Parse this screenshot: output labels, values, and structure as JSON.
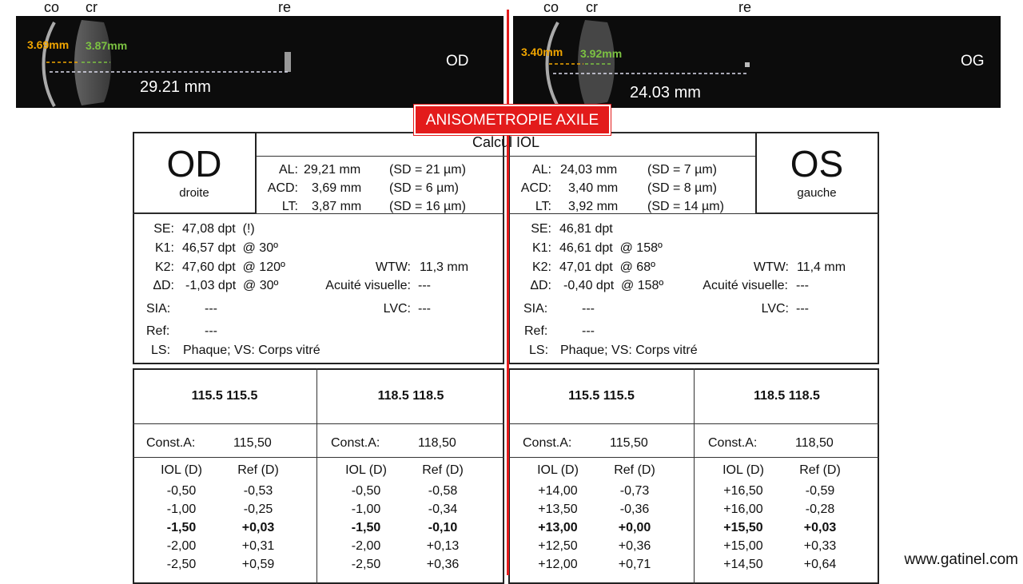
{
  "scans": {
    "od": {
      "labels": {
        "co": "co",
        "cr": "cr",
        "re": "re"
      },
      "acd": "3.69mm",
      "lt": "3.87mm",
      "axial": "29.21 mm",
      "eye": "OD"
    },
    "og": {
      "labels": {
        "co": "co",
        "cr": "cr",
        "re": "re"
      },
      "acd": "3.40mm",
      "lt": "3.92mm",
      "axial": "24.03 mm",
      "eye": "OG"
    }
  },
  "banner": "ANISOMETROPIE AXILE",
  "iol": {
    "title": "Calcul IOL",
    "od": {
      "eye": "OD",
      "eye_sub": "droite",
      "al": {
        "label": "AL:",
        "value": "29,21 mm",
        "sd": "(SD = 21 µm)"
      },
      "acd": {
        "label": "ACD:",
        "value": "3,69 mm",
        "sd": "(SD = 6 µm)"
      },
      "lt": {
        "label": "LT:",
        "value": "3,87 mm",
        "sd": "(SD = 16 µm)"
      },
      "se": {
        "label": "SE:",
        "value": "47,08 dpt  (!)"
      },
      "k1": {
        "label": "K1:",
        "value": "46,57 dpt  @ 30º"
      },
      "k2": {
        "label": "K2:",
        "value": "47,60 dpt  @ 120º"
      },
      "dd": {
        "label": "ΔD:",
        "value": "-1,03 dpt  @ 30º"
      },
      "wtw": {
        "label": "WTW:",
        "value": "11,3 mm"
      },
      "av": {
        "label": "Acuité visuelle:",
        "value": "---"
      },
      "sia": {
        "label": "SIA:",
        "value": "---"
      },
      "lvc": {
        "label": "LVC:",
        "value": "---"
      },
      "ref": {
        "label": "Ref:",
        "value": "---"
      },
      "ls": {
        "label": "LS:",
        "value": "Phaque; VS: Corps vitré"
      }
    },
    "os": {
      "eye": "OS",
      "eye_sub": "gauche",
      "al": {
        "label": "AL:",
        "value": "24,03 mm",
        "sd": "(SD = 7 µm)"
      },
      "acd": {
        "label": "ACD:",
        "value": "3,40 mm",
        "sd": "(SD = 8 µm)"
      },
      "lt": {
        "label": "LT:",
        "value": "3,92 mm",
        "sd": "(SD = 14 µm)"
      },
      "se": {
        "label": "SE:",
        "value": "46,81 dpt"
      },
      "k1": {
        "label": "K1:",
        "value": "46,61 dpt  @ 158º"
      },
      "k2": {
        "label": "K2:",
        "value": "47,01 dpt  @ 68º"
      },
      "dd": {
        "label": "ΔD:",
        "value": "-0,40 dpt  @ 158º"
      },
      "wtw": {
        "label": "WTW:",
        "value": "11,4 mm"
      },
      "av": {
        "label": "Acuité visuelle:",
        "value": "---"
      },
      "sia": {
        "label": "SIA:",
        "value": "---"
      },
      "lvc": {
        "label": "LVC:",
        "value": "---"
      },
      "ref": {
        "label": "Ref:",
        "value": "---"
      },
      "ls": {
        "label": "LS:",
        "value": "Phaque; VS: Corps vitré"
      }
    },
    "tables": [
      {
        "header": "115.5 115.5",
        "const_label": "Const.A:",
        "const_value": "115,50",
        "col_iol": "IOL (D)",
        "col_ref": "Ref (D)",
        "rows": [
          [
            "-0,50",
            "-0,53"
          ],
          [
            "-1,00",
            "-0,25"
          ],
          [
            "-1,50",
            "+0,03"
          ],
          [
            "-2,00",
            "+0,31"
          ],
          [
            "-2,50",
            "+0,59"
          ]
        ],
        "bold_row": 2
      },
      {
        "header": "118.5 118.5",
        "const_label": "Const.A:",
        "const_value": "118,50",
        "col_iol": "IOL (D)",
        "col_ref": "Ref (D)",
        "rows": [
          [
            "-0,50",
            "-0,58"
          ],
          [
            "-1,00",
            "-0,34"
          ],
          [
            "-1,50",
            "-0,10"
          ],
          [
            "-2,00",
            "+0,13"
          ],
          [
            "-2,50",
            "+0,36"
          ]
        ],
        "bold_row": 2
      },
      {
        "header": "115.5 115.5",
        "const_label": "Const.A:",
        "const_value": "115,50",
        "col_iol": "IOL (D)",
        "col_ref": "Ref (D)",
        "rows": [
          [
            "+14,00",
            "-0,73"
          ],
          [
            "+13,50",
            "-0,36"
          ],
          [
            "+13,00",
            "+0,00"
          ],
          [
            "+12,50",
            "+0,36"
          ],
          [
            "+12,00",
            "+0,71"
          ]
        ],
        "bold_row": 2
      },
      {
        "header": "118.5 118.5",
        "const_label": "Const.A:",
        "const_value": "118,50",
        "col_iol": "IOL (D)",
        "col_ref": "Ref (D)",
        "rows": [
          [
            "+16,50",
            "-0,59"
          ],
          [
            "+16,00",
            "-0,28"
          ],
          [
            "+15,50",
            "+0,03"
          ],
          [
            "+15,00",
            "+0,33"
          ],
          [
            "+14,50",
            "+0,64"
          ]
        ],
        "bold_row": 2
      }
    ]
  },
  "footer": "www.gatinel.com",
  "colors": {
    "accent_red": "#e31b1b",
    "acd_orange": "#f0a500",
    "lt_green": "#7cc242"
  }
}
